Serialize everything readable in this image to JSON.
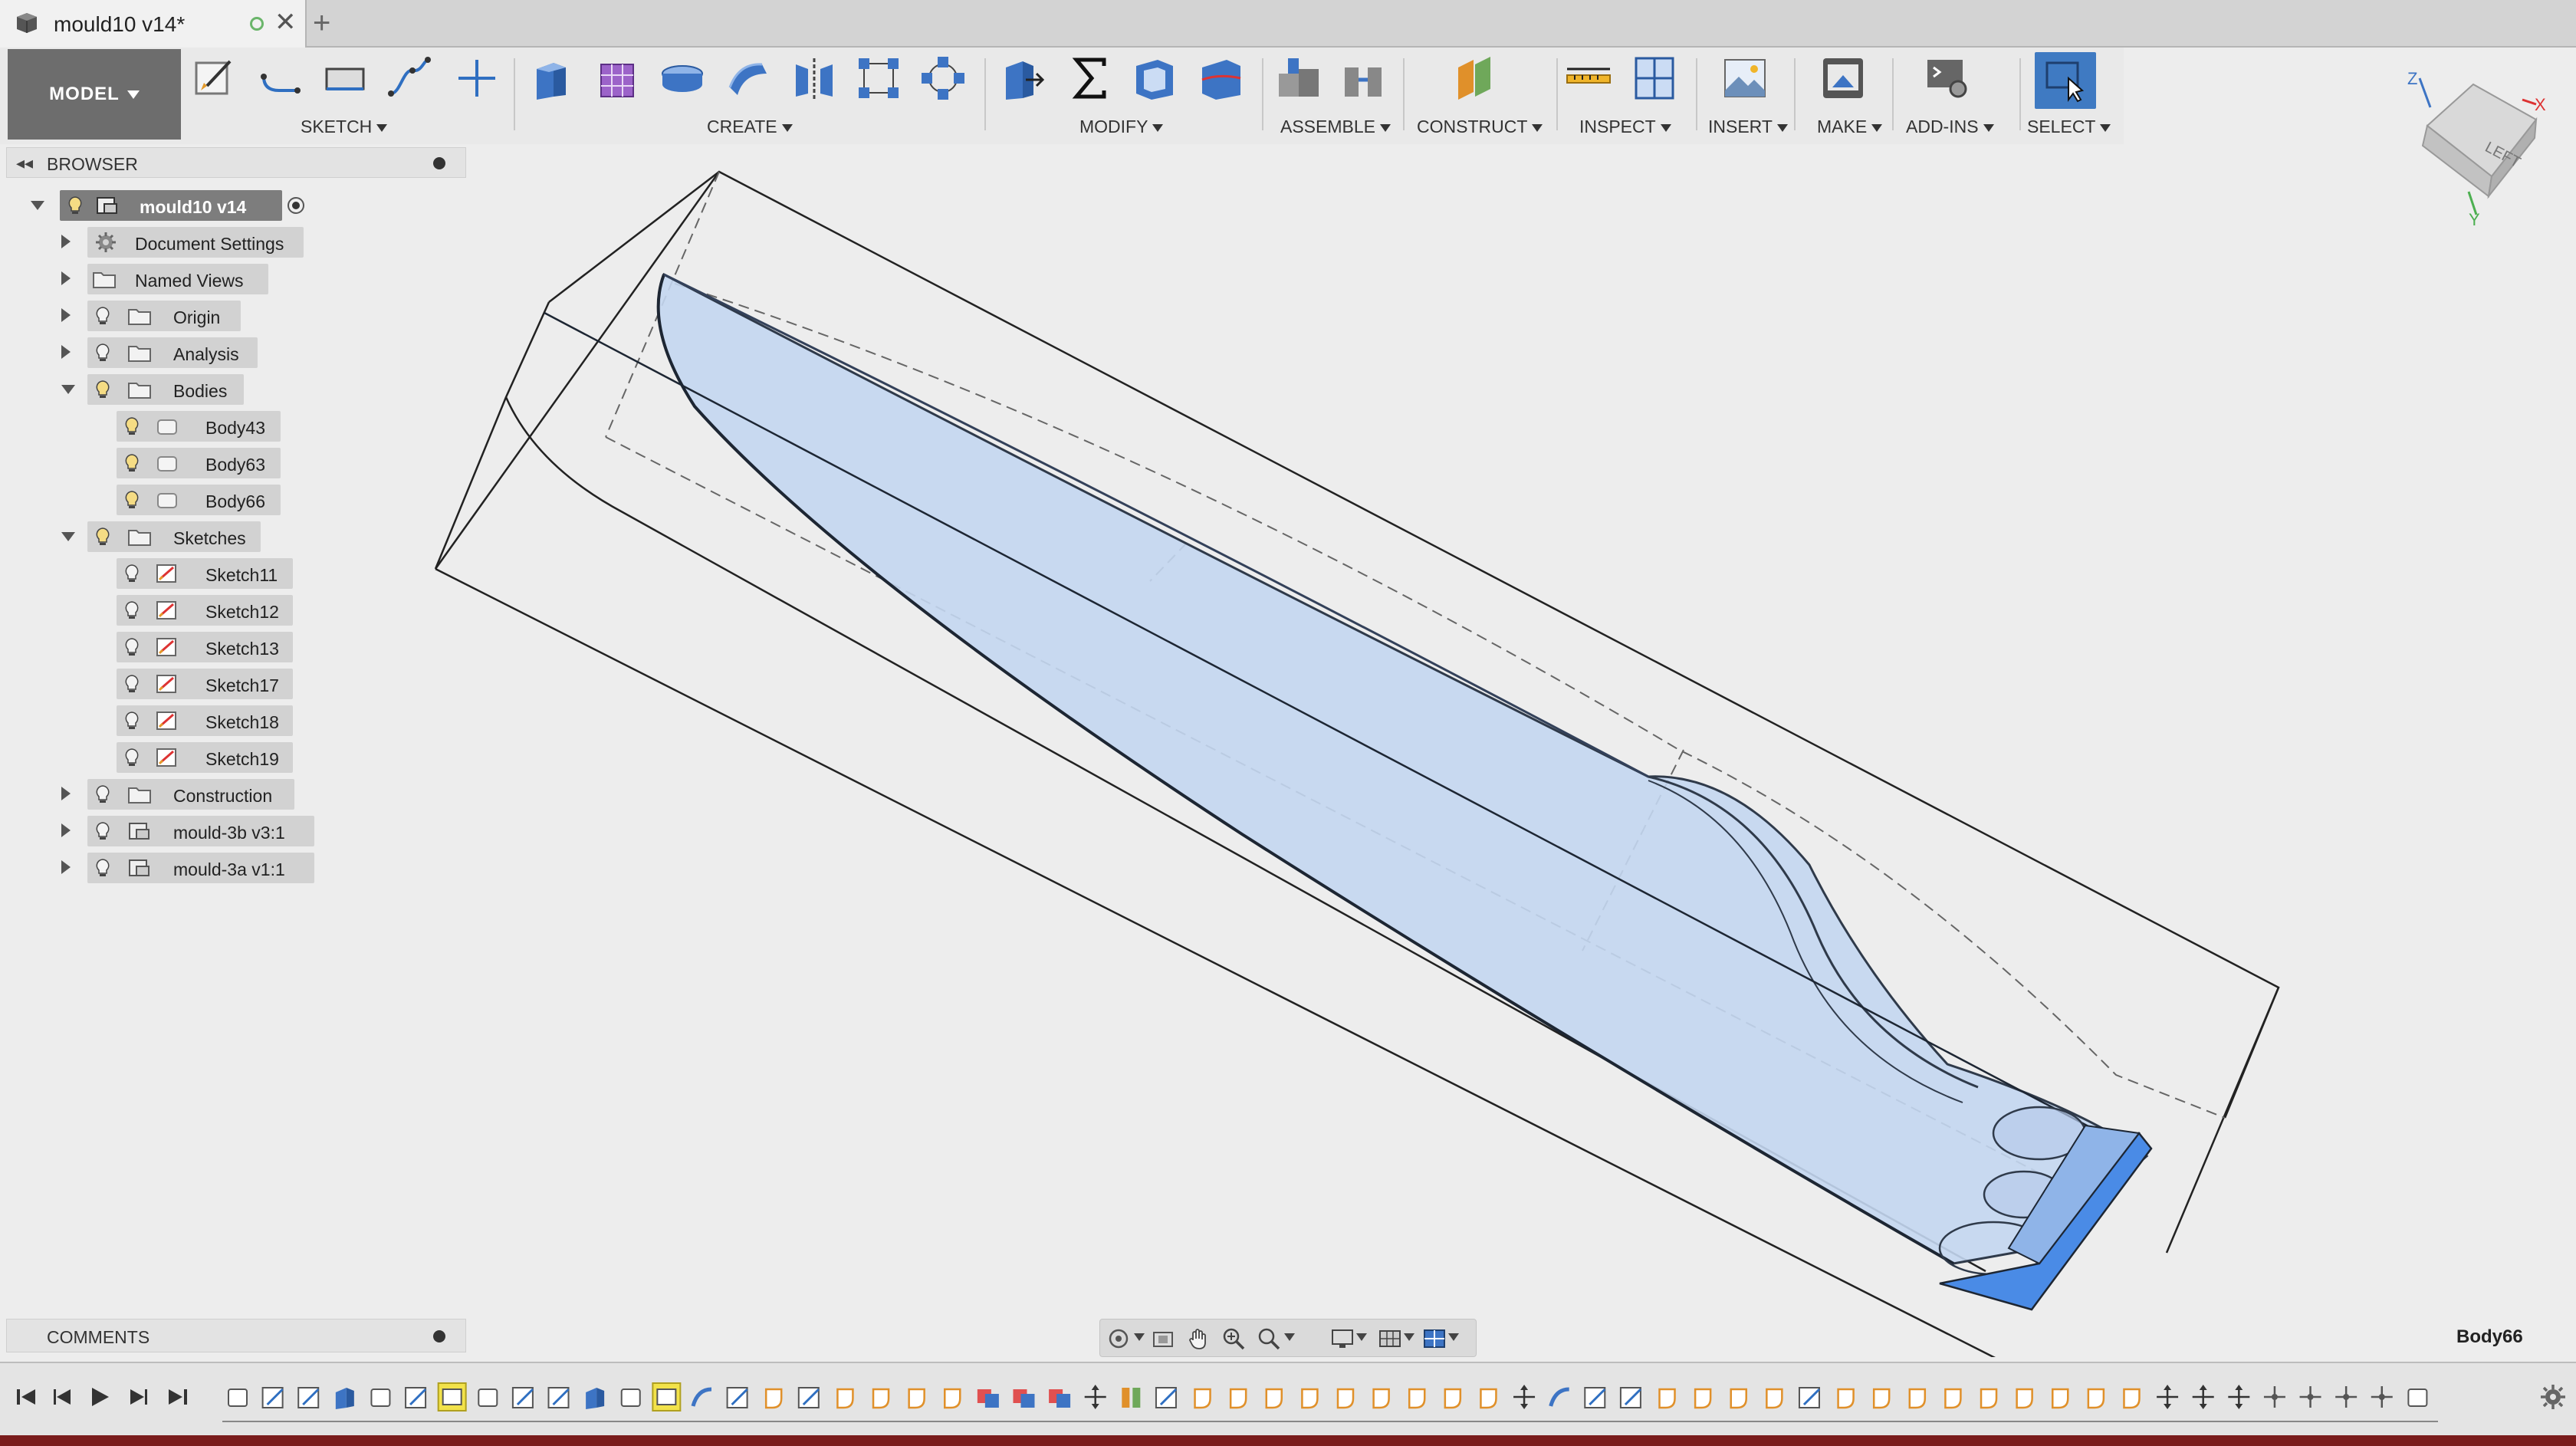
{
  "tab": {
    "title": "mould10 v14*",
    "new_tab_symbol": "+",
    "close_symbol": "✕"
  },
  "toolbar": {
    "workspace_label": "MODEL",
    "groups": {
      "sketch": "SKETCH",
      "create": "CREATE",
      "modify": "MODIFY",
      "assemble": "ASSEMBLE",
      "construct": "CONSTRUCT",
      "inspect": "INSPECT",
      "insert": "INSERT",
      "make": "MAKE",
      "addins": "ADD-INS",
      "select": "SELECT"
    }
  },
  "viewcube": {
    "face_label": "LEFT",
    "axis_z": "Z",
    "axis_x": "X",
    "axis_y": "Y"
  },
  "browser": {
    "title": "BROWSER",
    "root": "mould10 v14",
    "items": {
      "document_settings": "Document Settings",
      "named_views": "Named Views",
      "origin": "Origin",
      "analysis": "Analysis",
      "bodies": "Bodies",
      "body43": "Body43",
      "body63": "Body63",
      "body66": "Body66",
      "sketches": "Sketches",
      "sketch11": "Sketch11",
      "sketch12": "Sketch12",
      "sketch13": "Sketch13",
      "sketch17": "Sketch17",
      "sketch18": "Sketch18",
      "sketch19": "Sketch19",
      "construction": "Construction",
      "mould3b": "mould-3b v3:1",
      "mould3a": "mould-3a v1:1"
    }
  },
  "comments": {
    "title": "COMMENTS"
  },
  "status": {
    "selection": "Body66"
  },
  "colors": {
    "accent": "#3f7ac2",
    "body_fill": "#c3d6f0",
    "body_edge": "#2f3a4a",
    "face_blue": "#4a8be6"
  }
}
